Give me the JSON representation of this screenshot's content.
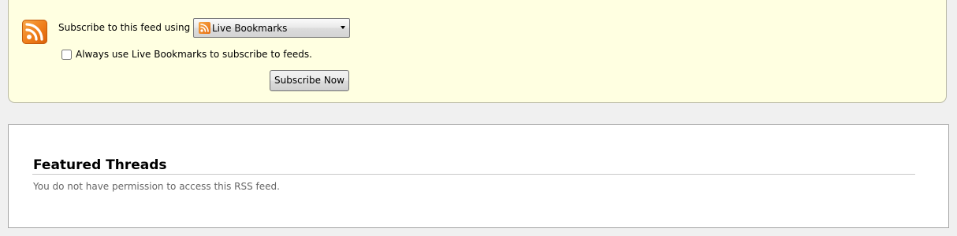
{
  "subscribe": {
    "label": "Subscribe to this feed using",
    "reader_selected": "Live Bookmarks",
    "always_use_label": "Always use Live Bookmarks to subscribe to feeds.",
    "always_use_checked": false,
    "button_label": "Subscribe Now",
    "logo_icon": "rss-feed-icon",
    "reader_icon": "live-bookmarks-icon"
  },
  "feed": {
    "title": "Featured Threads",
    "message": "You do not have permission to access this RSS feed."
  },
  "colors": {
    "subscribe_box_background": "#ffffe1",
    "rss_orange": "#ef7d1a",
    "page_background": "#f0f0f0",
    "message_text": "#666666"
  }
}
